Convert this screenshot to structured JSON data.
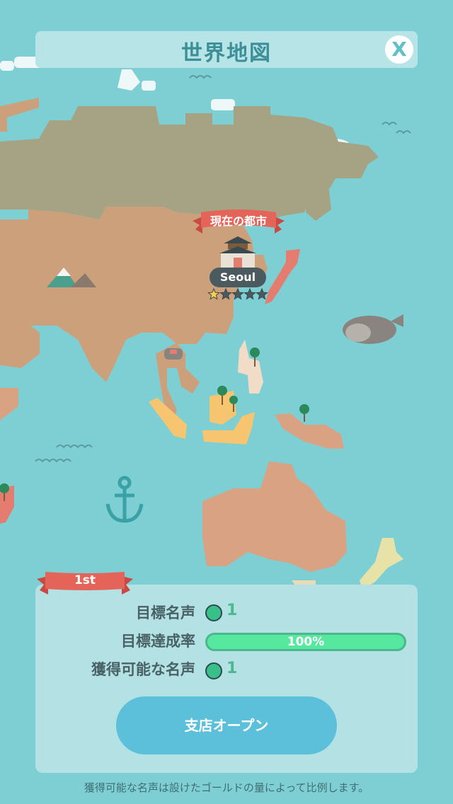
{
  "header": {
    "title": "世界地図",
    "close_label": "X"
  },
  "map": {
    "current_city_label": "現在の都市",
    "city_name": "Seoul",
    "city_stars": 1,
    "city_stars_max": 5
  },
  "goal_panel": {
    "rank": "1st",
    "target_fame_label": "目標名声",
    "target_fame_value": "1",
    "achievement_label": "目標達成率",
    "achievement_percent": 100,
    "achievement_text": "100%",
    "obtainable_fame_label": "獲得可能な名声",
    "obtainable_fame_value": "1",
    "open_button_label": "支店オープン"
  },
  "footnote": "獲得可能な名声は設けたゴールドの量によって比例します。",
  "colors": {
    "ocean": "#7ecfd4",
    "land_tan": "#cda07c",
    "land_olive": "#a5a383",
    "land_salmon": "#d9a283",
    "ribbon_red": "#e5645a",
    "progress_green": "#57e8a0",
    "button_blue": "#5cc0db"
  }
}
